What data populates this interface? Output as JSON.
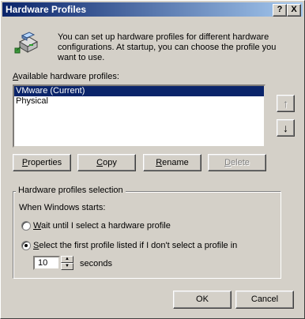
{
  "window": {
    "title": "Hardware Profiles",
    "help_label": "?",
    "close_label": "X"
  },
  "intro": {
    "text": "You can set up hardware profiles for different hardware configurations.  At startup, you can choose the profile you want to use."
  },
  "list": {
    "label_first": "A",
    "label_rest": "vailable hardware profiles:",
    "items": [
      "VMware (Current)",
      "Physical"
    ],
    "selected_index": 0
  },
  "move": {
    "up_glyph": "↑",
    "down_glyph": "↓"
  },
  "buttons": {
    "properties_a": "P",
    "properties_b": "roperties",
    "copy_a": "C",
    "copy_b": "opy",
    "rename_a": "R",
    "rename_b": "ename",
    "delete_a": "D",
    "delete_b": "elete",
    "ok": "OK",
    "cancel": "Cancel"
  },
  "selection": {
    "group_title": "Hardware profiles selection",
    "when_label": "When Windows starts:",
    "option_wait_a": "W",
    "option_wait_b": "ait until I select a hardware profile",
    "option_first_a": "S",
    "option_first_b": "elect the first profile listed if I don't select a profile in",
    "selected_option": "first",
    "seconds_value": "10",
    "seconds_label": "seconds"
  }
}
